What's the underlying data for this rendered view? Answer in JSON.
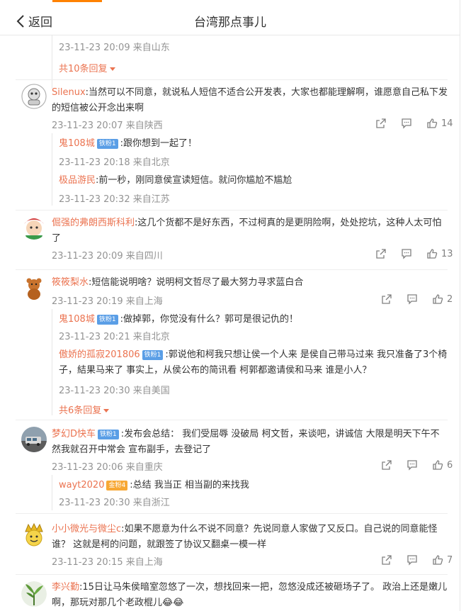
{
  "nav": {
    "back_label": "返回",
    "title": "台湾那点事儿"
  },
  "top_thread": {
    "time": "23-11-23 20:09 来自山东",
    "more_replies": "共10条回复"
  },
  "comments": [
    {
      "user": "Silenux",
      "text": "当然可以不同意，就说私人短信不适合公开发表，大家也都能理解啊，谁愿意自己私下发的短信被公开念出来啊",
      "time": "23-11-23 20:07 来自陕西",
      "likes": "14",
      "replies": [
        {
          "user": "鬼108城",
          "badge": "铁粉1",
          "text": "跟你想到一起了！",
          "time": "23-11-23 20:18 来自北京"
        },
        {
          "user": "极品游民",
          "badge": "",
          "text": "前一秒，刚同意侯宣读短信。就问你尴尬不尴尬",
          "time": "23-11-23 20:32 来自江苏"
        }
      ]
    },
    {
      "user": "倔强的弗朗西斯科利",
      "text": "这几个货都不是好东西，不过柯真的是更阴险啊，处处挖坑，这种人太可怕了",
      "time": "23-11-23 20:09 来自四川",
      "likes": "13",
      "replies": []
    },
    {
      "user": "筱筱梨水",
      "text": "短信能说明啥？说明柯文哲尽了最大努力寻求蓝白合",
      "time": "23-11-23 20:19 来自上海",
      "likes": "2",
      "replies": [
        {
          "user": "鬼108城",
          "badge": "铁粉1",
          "text": "做掉郭，你觉没有什么？郭可是很记仇的！",
          "time": "23-11-23 20:21 来自北京"
        },
        {
          "user": "傲娇的孤寂201806",
          "badge": "铁粉1",
          "text": "郭说他和柯我只想让侯一个人来  是侯自己带马过来 我只准备了3个椅子，結果马来了  事实上，从侯公布的简讯看  柯郭都邀请侯和马来 谁是小人？",
          "time": "23-11-23 20:30 来自美国"
        }
      ],
      "more_replies": "共6条回复"
    },
    {
      "user": "梦幻D快车",
      "badge": "铁粉1",
      "text": "发布会总结：  我们受屈辱 没破局 柯文哲，来谈吧，讲诚信 大限是明天下午不然我就召开中常会 宣布副手，去登记了",
      "time": "23-11-23 20:06 来自重庆",
      "likes": "6",
      "replies": [
        {
          "user": "wayt2020",
          "badge": "金粉4",
          "text": "总结 我当正 相当副的来找我",
          "time": "23-11-23 20:30 来自浙江"
        }
      ]
    },
    {
      "user": "小小微光与微尘c",
      "text": "如果不愿意为什么不说不同意？先说同意人家做了又反口。自己说的同意能怪谁？ 这就是柯的问题，就跟签了协议又翻桌一模一样",
      "time": "23-11-23 20:15 来自上海",
      "likes": "7",
      "replies": []
    },
    {
      "user": "李兴勤",
      "text": "15日让马朱侯暗室忽悠了一次，想找回来一把，忽悠没成还被砸场子了。 政治上还是嫩儿啊，那玩对那几个老政棍儿",
      "emoji": "😂😂",
      "time": "",
      "likes": "",
      "replies": []
    }
  ],
  "colors": {
    "accent": "#ff8200",
    "username": "#eb7350",
    "meta": "#939393",
    "badge_blue": "#5a9ee6",
    "badge_gold": "#f7a835"
  },
  "icons": [
    "chevron-left-icon",
    "share-icon",
    "comment-icon",
    "like-icon"
  ]
}
